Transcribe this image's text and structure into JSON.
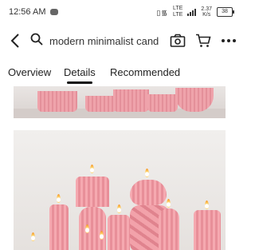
{
  "status": {
    "time": "12:56 AM",
    "network": "LTE",
    "network_sub": "LTE",
    "speed_value": "2.37",
    "speed_unit": "K/s",
    "battery": "38"
  },
  "search": {
    "query": "modern minimalist candl..."
  },
  "tabs": [
    {
      "label": "Overview",
      "active": false
    },
    {
      "label": "Details",
      "active": true
    },
    {
      "label": "Recommended",
      "active": false
    }
  ],
  "images": [
    {
      "name": "candles-shelf-photo"
    },
    {
      "name": "lit-pink-candles-photo"
    }
  ],
  "colors": {
    "candle_pink": "#f5a9b0",
    "flame": "#ffd36b",
    "background": "#ffffff"
  },
  "icons": [
    "chat-icon",
    "vibrate-icon",
    "signal-icon",
    "battery-icon",
    "back-icon",
    "search-icon",
    "camera-icon",
    "cart-icon",
    "more-icon"
  ]
}
